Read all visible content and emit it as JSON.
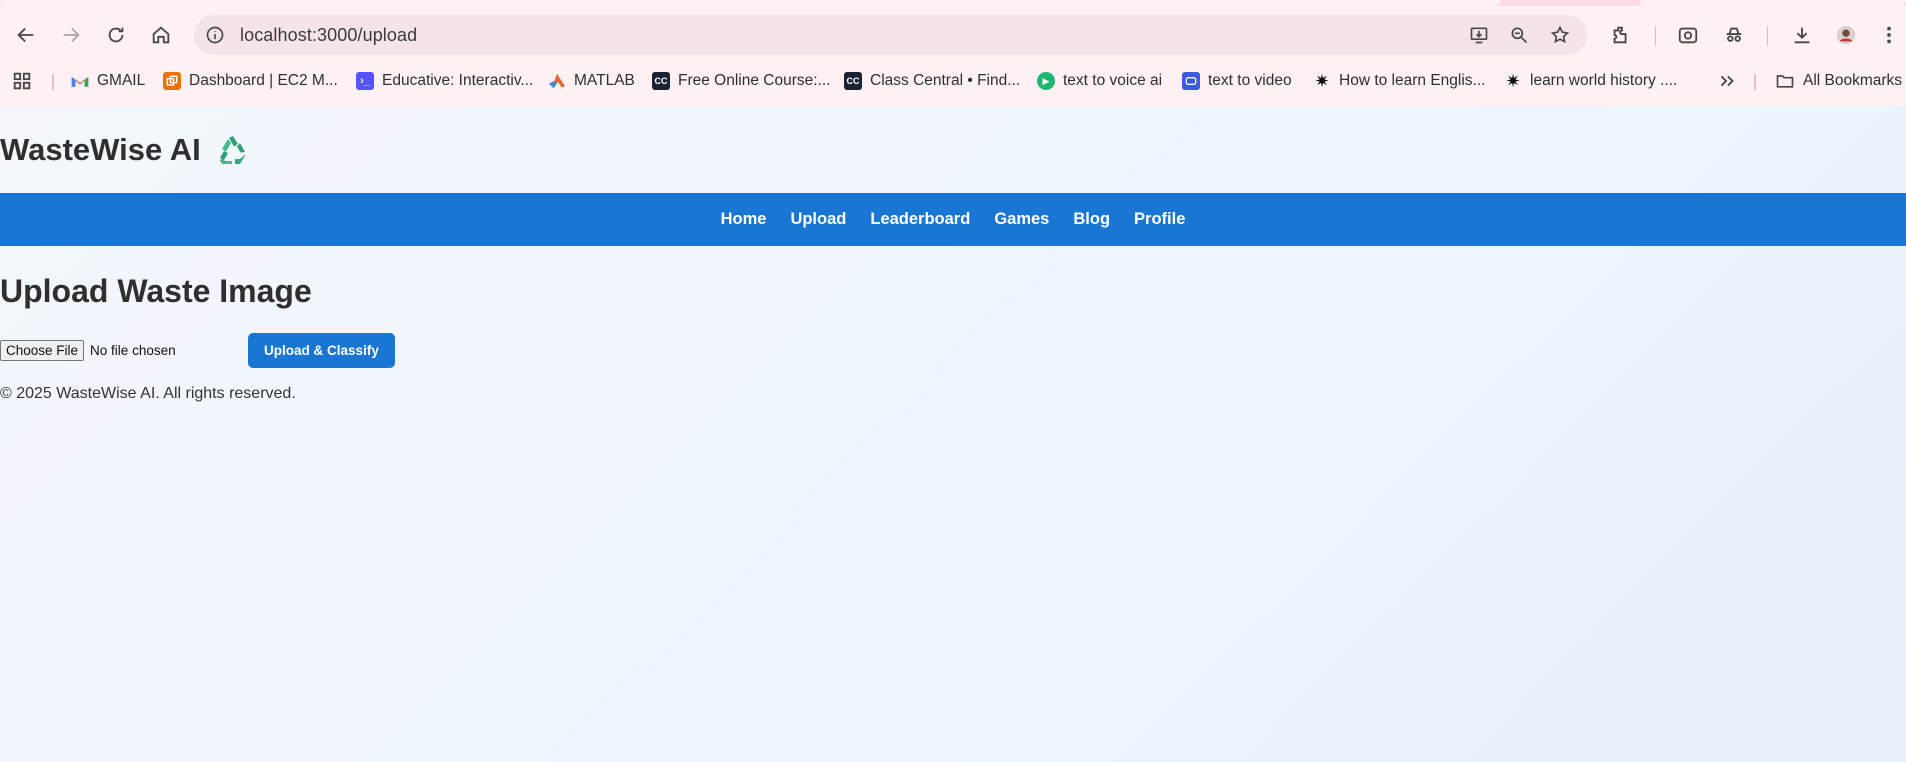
{
  "browser": {
    "url": "localhost:3000/upload",
    "bookmarks": [
      {
        "label": "GMAIL",
        "icon": "gmail-icon",
        "color": "#ea4335"
      },
      {
        "label": "Dashboard | EC2 M...",
        "icon": "aws-icon",
        "color": "#e8730c"
      },
      {
        "label": "Educative: Interactiv...",
        "icon": "educative-icon",
        "color": "#5553ff"
      },
      {
        "label": "MATLAB",
        "icon": "matlab-icon",
        "color": "#e16737"
      },
      {
        "label": "Free Online Course:...",
        "icon": "classcentral-icon",
        "color": "#1b2333"
      },
      {
        "label": "Class Central • Find...",
        "icon": "classcentral-icon",
        "color": "#1b2333"
      },
      {
        "label": "text to voice ai",
        "icon": "play-icon",
        "color": "#1fb872"
      },
      {
        "label": "text to video",
        "icon": "video-icon",
        "color": "#3b5bdb"
      },
      {
        "label": "How to learn Englis...",
        "icon": "spark-icon",
        "color": "#111111"
      },
      {
        "label": "learn world history ....",
        "icon": "spark-icon",
        "color": "#111111"
      }
    ],
    "all_bookmarks_label": "All Bookmarks"
  },
  "site": {
    "title": "WasteWise AI",
    "logo_icon": "recycle-icon",
    "nav": [
      "Home",
      "Upload",
      "Leaderboard",
      "Games",
      "Blog",
      "Profile"
    ],
    "accent_color": "#1976d2"
  },
  "upload": {
    "heading": "Upload Waste Image",
    "choose_file_label": "Choose File",
    "file_status": "No file chosen",
    "submit_label": "Upload & Classify"
  },
  "footer": {
    "text": "© 2025 WasteWise AI. All rights reserved."
  }
}
